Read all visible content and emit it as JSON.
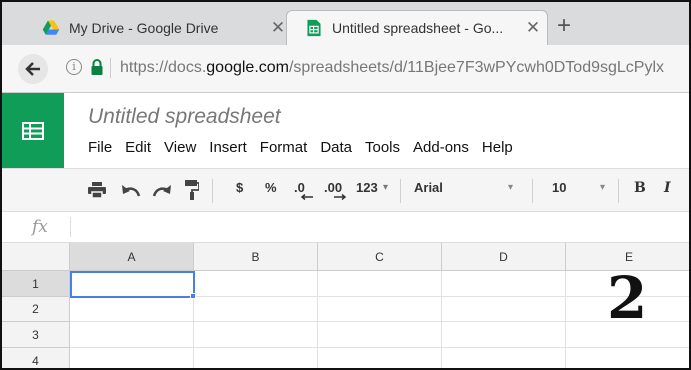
{
  "browser": {
    "tabs": [
      {
        "title": "My Drive - Google Drive",
        "icon": "google-drive-icon",
        "active": false
      },
      {
        "title": "Untitled spreadsheet - Go...",
        "icon": "google-sheets-icon",
        "active": true
      }
    ],
    "tab_close_glyph": "✕",
    "new_tab_glyph": "+",
    "url_prefix": "https://docs.",
    "url_domain": "google.com",
    "url_path": "/spreadsheets/d/11Bjee7F3wPYcwh0DTod9sgLcPylx"
  },
  "docs": {
    "title": "Untitled spreadsheet",
    "menu": [
      "File",
      "Edit",
      "View",
      "Insert",
      "Format",
      "Data",
      "Tools",
      "Add-ons",
      "Help"
    ]
  },
  "toolbar": {
    "currency": "$",
    "percent": "%",
    "decrease_decimals": ".0",
    "increase_decimals": ".00",
    "more_formats": "123",
    "font": "Arial",
    "font_size": "10",
    "bold": "B",
    "italic": "I"
  },
  "formula_bar": {
    "label": "fx"
  },
  "grid": {
    "columns": [
      "A",
      "B",
      "C",
      "D",
      "E"
    ],
    "rows": [
      "1",
      "2",
      "3",
      "4"
    ],
    "selected_cell": "A1"
  },
  "overlay_number": "2",
  "colors": {
    "sheets_green": "#0f9d58",
    "selection_blue": "#4a7ee8"
  }
}
